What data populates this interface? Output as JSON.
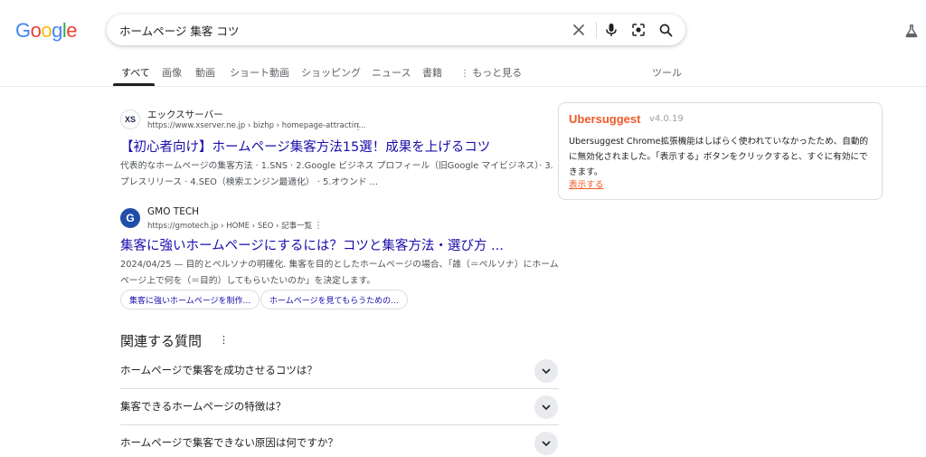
{
  "logo": {
    "letters": [
      "G",
      "o",
      "o",
      "g",
      "l",
      "e"
    ],
    "colors": [
      "#4285F4",
      "#EA4335",
      "#FBBC05",
      "#4285F4",
      "#34A853",
      "#EA4335"
    ]
  },
  "search": {
    "query": "ホームページ 集客 コツ"
  },
  "icons": {
    "clear": "close-icon",
    "voice": "mic-icon",
    "lens": "lens-icon",
    "search": "search-icon",
    "labs": "flask-icon"
  },
  "tabs": [
    {
      "label": "すべて",
      "active": true
    },
    {
      "label": "画像"
    },
    {
      "label": "動画"
    },
    {
      "label": "ショート動画"
    },
    {
      "label": "ショッピング"
    },
    {
      "label": "ニュース"
    },
    {
      "label": "書籍"
    },
    {
      "label": "もっと見る"
    }
  ],
  "tools_label": "ツール",
  "results": [
    {
      "site": "エックスサーバー",
      "url": "https://www.xserver.ne.jp › bizhp › homepage-attractin...",
      "favicon_text": "XS",
      "title": "【初心者向け】ホームページ集客方法15選！成果を上げるコツ",
      "snippet": "代表的なホームページの集客方法 · 1.SNS · 2.Google ビジネス プロフィール（旧Google マイビジネス）· 3.プレスリリース · 4.SEO（検索エンジン最適化） · 5.オウンド ..."
    },
    {
      "site": "GMO TECH",
      "url": "https://gmotech.jp › HOME › SEO › 記事一覧",
      "favicon_text": "G",
      "title": "集客に強いホームページにするには？コツと集客方法・選び方 ...",
      "snippet": "2024/04/25 — 目的とペルソナの明確化. 集客を目的としたホームページの場合、「誰（＝ペルソナ）にホームページ上で何を（＝目的）してもらいたいのか」を決定します。"
    }
  ],
  "chips": [
    "集客に強いホームページを制作...",
    "ホームページを見てもらうための..."
  ],
  "paa": {
    "title": "関連する質問",
    "questions": [
      "ホームページで集客を成功させるコツは？",
      "集客できるホームページの特徴は？",
      "ホームページで集客できない原因は何ですか？"
    ]
  },
  "extension": {
    "name": "Ubersuggest",
    "version": "v4.0.19",
    "message": "Ubersuggest Chrome拡張機能はしばらく使われていなかったため、自動的に無効化されました。「表示する」ボタンをクリックすると、すぐに有効にできます。",
    "link": "表示する",
    "accent": "#f05a28"
  }
}
